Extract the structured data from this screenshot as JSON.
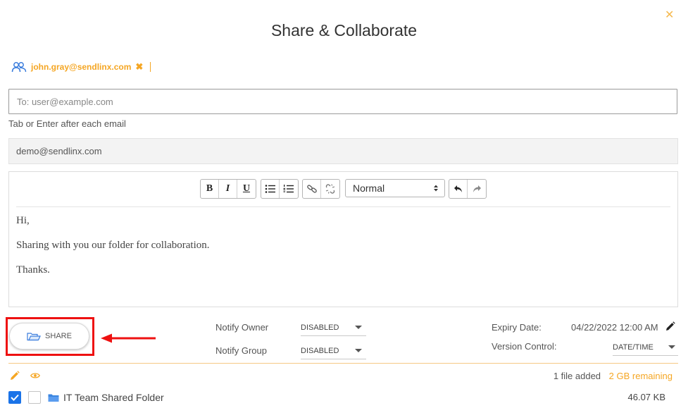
{
  "dialog": {
    "title": "Share & Collaborate",
    "close_icon": "close-icon"
  },
  "recipient_chip": {
    "icon": "users-icon",
    "email": "john.gray@sendlinx.com",
    "remove": "✖"
  },
  "to_field": {
    "placeholder": "To: user@example.com",
    "value": "",
    "hint": "Tab or Enter after each email"
  },
  "from_field": {
    "value": "demo@sendlinx.com"
  },
  "editor": {
    "toolbar": {
      "bold": "B",
      "italic": "I",
      "underline": "U",
      "bullet_list_icon": "bullet-list-icon",
      "ordered_list_icon": "ordered-list-icon",
      "link_icon": "link-icon",
      "unlink_icon": "unlink-icon",
      "format_value": "Normal",
      "undo_icon": "undo-icon",
      "redo_icon": "redo-icon"
    },
    "body": [
      "Hi,",
      "Sharing with you our folder for collaboration.",
      "Thanks."
    ]
  },
  "share_button": {
    "label": "SHARE",
    "icon": "share-folder-icon"
  },
  "notify": {
    "owner_label": "Notify Owner",
    "owner_value": "DISABLED",
    "group_label": "Notify Group",
    "group_value": "DISABLED"
  },
  "expiry": {
    "label": "Expiry Date:",
    "value": "04/22/2022 12:00 AM",
    "edit_icon": "pencil-icon"
  },
  "version_control": {
    "label": "Version Control:",
    "value": "DATE/TIME"
  },
  "files": {
    "added_text": "1 file added",
    "remaining_text": "2 GB remaining",
    "items": [
      {
        "name": "IT Team Shared Folder",
        "size": "46.07 KB",
        "checked": true
      }
    ]
  },
  "colors": {
    "accent": "#f5a623",
    "highlight": "#ee1111",
    "checkbox": "#1a73e8"
  }
}
